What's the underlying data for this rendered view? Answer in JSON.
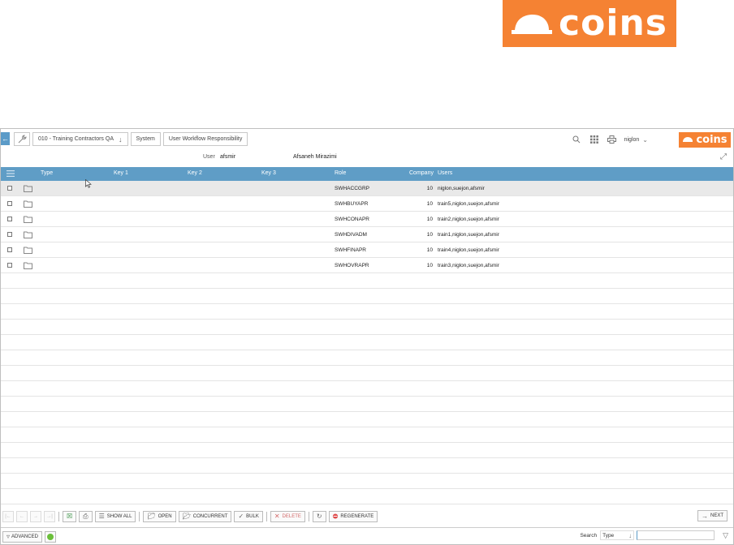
{
  "brand": {
    "logo_text": "coins",
    "color": "#f58233"
  },
  "breadcrumb": {
    "company": "010 - Training Contractors QA",
    "module": "System",
    "page": "User Workflow Responsibility"
  },
  "header": {
    "user_name": "niglon",
    "icons": [
      "search-icon",
      "grid-icon",
      "print-icon"
    ]
  },
  "user_info": {
    "label": "User",
    "user_id": "afsmir",
    "full_name": "Afsaneh Mirazimi"
  },
  "grid": {
    "header_color": "#5f9dc6",
    "columns": {
      "type": "Type",
      "key1": "Key 1",
      "key2": "Key 2",
      "key3": "Key 3",
      "role": "Role",
      "company": "Company",
      "users": "Users"
    },
    "rows": [
      {
        "role": "SWHACCGRP",
        "company": "10",
        "users": "niglon,suejon,afsmir"
      },
      {
        "role": "SWHBUYAPR",
        "company": "10",
        "users": "train5,niglon,suejon,afsmir"
      },
      {
        "role": "SWHCONAPR",
        "company": "10",
        "users": "train2,niglon,suejon,afsmir"
      },
      {
        "role": "SWHDIVADM",
        "company": "10",
        "users": "train1,niglon,suejon,afsmir"
      },
      {
        "role": "SWHFINAPR",
        "company": "10",
        "users": "train4,niglon,suejon,afsmir"
      },
      {
        "role": "SWHOVRAPR",
        "company": "10",
        "users": "train3,niglon,suejon,afsmir"
      }
    ]
  },
  "toolbar": {
    "show_all": "SHOW ALL",
    "open": "OPEN",
    "concurrent": "CONCURRENT",
    "bulk": "BULK",
    "delete": "DELETE",
    "regenerate": "REGENERATE",
    "next": "NEXT"
  },
  "statusbar": {
    "advanced": "ADVANCED",
    "search_label": "Search",
    "search_type": "Type",
    "search_value": ""
  }
}
